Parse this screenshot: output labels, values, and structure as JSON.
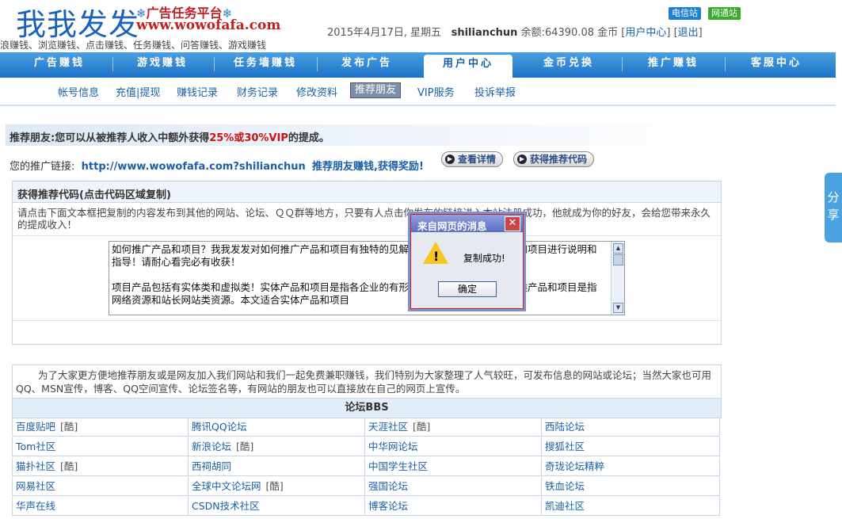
{
  "header": {
    "logo": "我我发发",
    "platform": "广告任务平台",
    "url": "www.wowofafa.com",
    "tagline": "浪赚钱、浏览赚钱、点击赚钱、任务赚钱、问答赚钱、游戏赚钱",
    "date": "2015年4月17日, 星期五",
    "username": "shilianchun",
    "balance_label": "余额:64390.08 金币",
    "user_center_link": "用户中心",
    "logout_link": "退出",
    "telecom_btn": "电信站",
    "netcom_btn": "网通站",
    "flake": "❄"
  },
  "nav": {
    "items": [
      "广告赚钱",
      "游戏赚钱",
      "任务墙赚钱",
      "发布广告",
      "用户中心",
      "金币兑换",
      "推广赚钱",
      "客服中心"
    ],
    "active": "用户中心"
  },
  "subnav": {
    "items": [
      "帐号信息",
      "充值|提现",
      "赚钱记录",
      "财务记录",
      "修改资料",
      "推荐朋友",
      "VIP服务",
      "投诉举报"
    ],
    "active": "推荐朋友"
  },
  "banner": {
    "prefix": "推荐朋友:您可以从被推荐人收入中额外获得",
    "highlight": "25%或30%VIP",
    "suffix": "的提成。"
  },
  "promo": {
    "label": "您的推广链接:",
    "link": "http://www.wowofafa.com?shilianchun",
    "slogan": "推荐朋友赚钱,获得奖励!",
    "detail_btn": "查看详情",
    "code_btn": "获得推荐代码"
  },
  "panel": {
    "title": "获得推荐代码(点击代码区域复制)",
    "desc": "请点击下面文本框把复制的内容发布到其他的网站、论坛、ＱＱ群等地方，只要有人点击你发布的链接进入本站注册成功，他就成为你的好友，会给您带来永久的提成收入！",
    "textbox": "如何推广产品和项目？我我发发对如何推广产品和项目有独特的见解，今天我就如何推广产品和项目进行说明和指导！请耐心看完必有收获！\n\n项目产品包括有实体类和虚拟类！实体产品和项目是指各企业的有形产品和服务类项目。虚拟类产品和项目是指网络资源和站长网站类资源。本文适合实体产品和项目"
  },
  "intro": {
    "text": "为了大家更方便地推荐朋友或是网友加入我们网站和我们一起免费兼职赚钱，我们特别为大家整理了人气较旺，可发布信息的网站或论坛；当然大家也可用QQ、MSN宣传，博客、QQ空间宣传、论坛签名等，有网站的朋友也可以直接放在自己的网页上宣传。"
  },
  "bbs": {
    "title": "论坛BBS",
    "rows": [
      [
        {
          "name": "百度贴吧",
          "tag": "[酷]"
        },
        {
          "name": "腾讯QQ论坛",
          "tag": ""
        },
        {
          "name": "天涯社区",
          "tag": "[酷]"
        },
        {
          "name": "西陆论坛",
          "tag": ""
        }
      ],
      [
        {
          "name": "Tom社区",
          "tag": ""
        },
        {
          "name": "新浪论坛",
          "tag": "[酷]"
        },
        {
          "name": "中华网论坛",
          "tag": ""
        },
        {
          "name": "搜狐社区",
          "tag": ""
        }
      ],
      [
        {
          "name": "猫扑社区",
          "tag": "[酷]"
        },
        {
          "name": "西祠胡同",
          "tag": ""
        },
        {
          "name": "中国学生社区",
          "tag": ""
        },
        {
          "name": "奇珑论坛精粹",
          "tag": ""
        }
      ],
      [
        {
          "name": "网易社区",
          "tag": ""
        },
        {
          "name": "全球中文论坛网",
          "tag": "[酷]"
        },
        {
          "name": "强国论坛",
          "tag": ""
        },
        {
          "name": "铁血论坛",
          "tag": ""
        }
      ],
      [
        {
          "name": "华声在线",
          "tag": ""
        },
        {
          "name": "CSDN技术社区",
          "tag": ""
        },
        {
          "name": "博客论坛",
          "tag": ""
        },
        {
          "name": "凯迪社区",
          "tag": ""
        }
      ]
    ]
  },
  "dialog": {
    "title": "来自网页的消息",
    "message": "复制成功!",
    "ok": "确定",
    "close": "✕",
    "icon_mark": "!"
  },
  "share": {
    "label": "分享"
  },
  "colors": {
    "nav": "#1c72c6",
    "highlight": "#d01010",
    "link": "#1a5ea8"
  }
}
